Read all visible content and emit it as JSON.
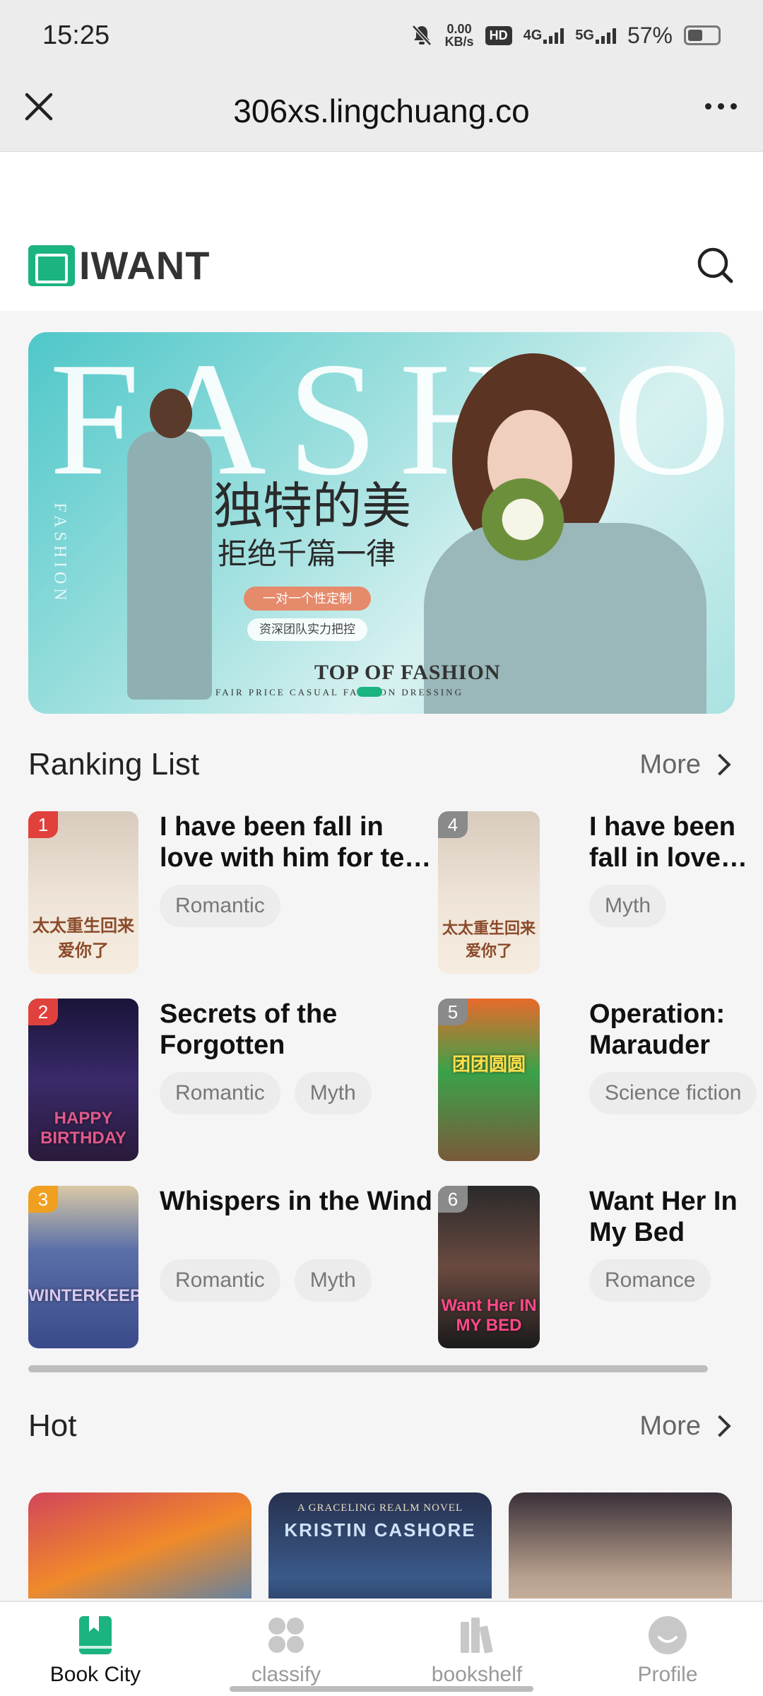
{
  "status_bar": {
    "time": "15:25",
    "net_speed_value": "0.00",
    "net_speed_unit": "KB/s",
    "hd": "HD",
    "sim1": "4G",
    "sim2": "5G",
    "battery": "57%"
  },
  "browser": {
    "url": "306xs.lingchuang.co"
  },
  "header": {
    "logo_text": "IWANT"
  },
  "banner": {
    "big_text": "FASHION",
    "side_text": "FASHION",
    "cn_line1": "独特的美",
    "cn_line2": "拒绝千篇一律",
    "pill1": "一对一个性定制",
    "pill2": "资深团队实力把控",
    "top_text": "TOP OF FASHION",
    "tagline": "FAIR PRICE CASUAL FASHION DRESSING"
  },
  "ranking": {
    "title": "Ranking List",
    "more": "More",
    "items": [
      {
        "rank": "1",
        "title": "I have been fall in love with him for te…",
        "tags": [
          "Romantic"
        ],
        "badge_color": "#e0413c",
        "cover_text": "太太重生回来爱你了"
      },
      {
        "rank": "2",
        "title": "Secrets of the Forgotten",
        "tags": [
          "Romantic",
          "Myth"
        ],
        "badge_color": "#e0413c",
        "cover_text": "HAPPY BIRTHDAY"
      },
      {
        "rank": "3",
        "title": "Whispers in the Wind",
        "tags": [
          "Romantic",
          "Myth"
        ],
        "badge_color": "#f0a020",
        "cover_text": "WINTERKEEP"
      },
      {
        "rank": "4",
        "title": "I have been fall in love with…",
        "tags": [
          "Myth"
        ],
        "badge_color": "#8a8a8a",
        "cover_text": "太太重生回来爱你了"
      },
      {
        "rank": "5",
        "title": "Operation: Marauder",
        "tags": [
          "Science fiction"
        ],
        "badge_color": "#8a8a8a",
        "cover_text": "团团圆圆"
      },
      {
        "rank": "6",
        "title": "Want Her In My Bed",
        "tags": [
          "Romance"
        ],
        "badge_color": "#8a8a8a",
        "cover_text": "Want Her IN MY BED"
      }
    ]
  },
  "hot": {
    "title": "Hot",
    "more": "More",
    "cards": [
      {
        "series": "",
        "author": ""
      },
      {
        "series": "A GRACELING REALM NOVEL",
        "author": "KRISTIN CASHORE"
      },
      {
        "series": "",
        "author": ""
      }
    ]
  },
  "nav": {
    "items": [
      {
        "label": "Book City",
        "icon": "book-icon",
        "active": true
      },
      {
        "label": "classify",
        "icon": "grid-icon",
        "active": false
      },
      {
        "label": "bookshelf",
        "icon": "bookshelf-icon",
        "active": false
      },
      {
        "label": "Profile",
        "icon": "profile-icon",
        "active": false
      }
    ]
  },
  "colors": {
    "accent": "#1bb37f",
    "rank_top": "#e0413c",
    "rank_third": "#f0a020"
  }
}
